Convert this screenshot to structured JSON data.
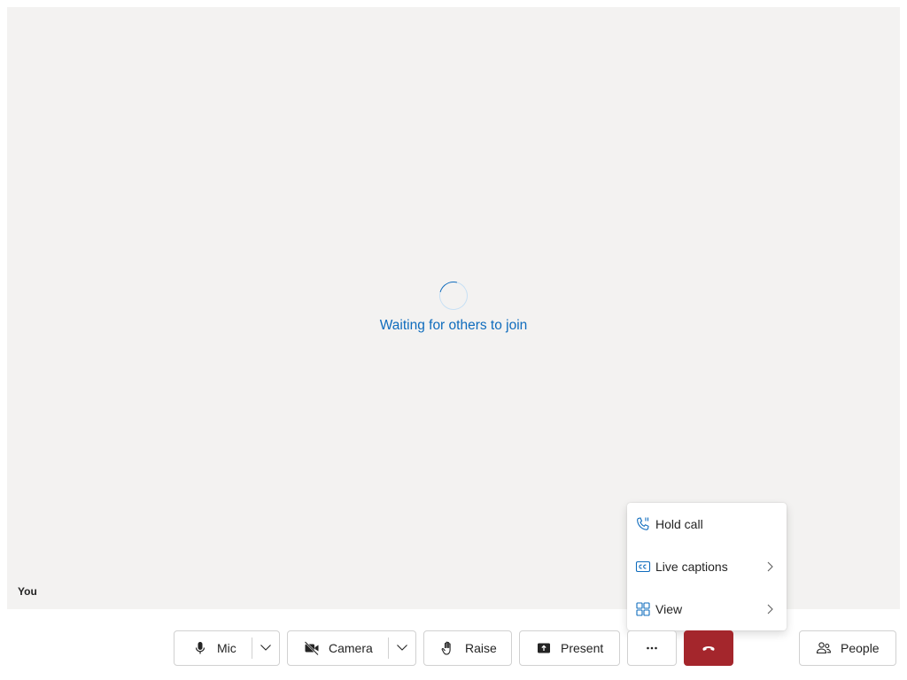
{
  "stage": {
    "waiting_text": "Waiting for others to join",
    "self_label": "You"
  },
  "toolbar": {
    "mic_label": "Mic",
    "camera_label": "Camera",
    "raise_label": "Raise",
    "present_label": "Present",
    "people_label": "People",
    "more_icon": "ellipsis-icon",
    "hangup_icon": "phone-hangup-icon",
    "hangup_color": "#a4262c"
  },
  "more_menu": {
    "items": [
      {
        "label": "Hold call",
        "icon": "phone-pause-icon",
        "has_submenu": false
      },
      {
        "label": "Live captions",
        "icon": "closed-captions-icon",
        "has_submenu": true
      },
      {
        "label": "View",
        "icon": "grid-icon",
        "has_submenu": true
      }
    ]
  },
  "colors": {
    "accent": "#0f6cbd",
    "stage_background": "#f3f2f1"
  }
}
